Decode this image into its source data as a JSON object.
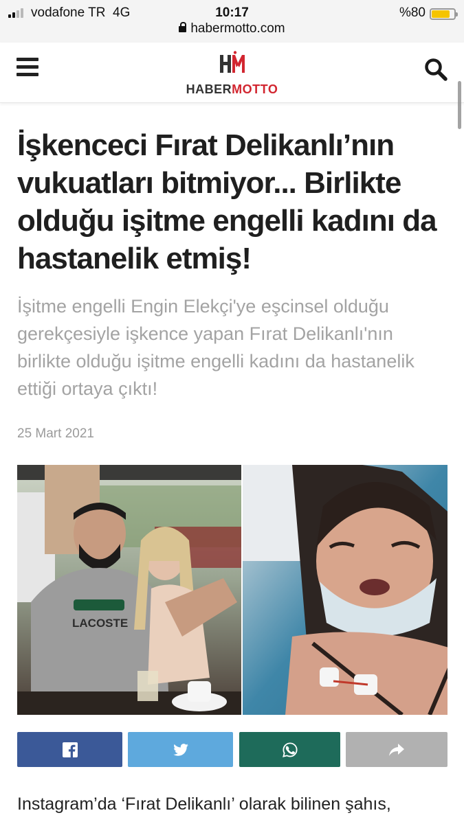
{
  "status_bar": {
    "carrier": "vodafone TR",
    "network": "4G",
    "time": "10:17",
    "battery": "%80",
    "battery_level": 0.8
  },
  "browser": {
    "url": "habermotto.com"
  },
  "site": {
    "logo_mark": "HM",
    "logo_name_part1": "HABER",
    "logo_name_part2": "MOTTO",
    "brand_color": "#d22630",
    "menu_icon": "hamburger-icon",
    "search_icon": "search-icon"
  },
  "article": {
    "title": "İşkenceci Fırat Delikanlı’nın vukuatları bitmiyor... Birlikte olduğu işitme engelli kadını da hastanelik etmiş!",
    "summary": "İşitme engelli Engin Elekçi'ye eşcinsel olduğu gerekçesiyle işkence yapan Fırat Delikanlı'nın birlikte olduğu işitme engelli kadını da hastanelik ettiği ortaya çıktı!",
    "date": "25 Mart 2021",
    "shirt_text": "LACOSTE",
    "body_start": "Instagram’da ‘Fırat Delikanlı’ olarak bilinen şahıs,"
  },
  "share": {
    "buttons": [
      {
        "name": "facebook",
        "icon": "facebook-icon",
        "color": "#3b5998"
      },
      {
        "name": "twitter",
        "icon": "twitter-icon",
        "color": "#5ea9dd"
      },
      {
        "name": "whatsapp",
        "icon": "whatsapp-icon",
        "color": "#1e6b5a"
      },
      {
        "name": "more",
        "icon": "share-arrow-icon",
        "color": "#b1b1b1"
      }
    ]
  }
}
